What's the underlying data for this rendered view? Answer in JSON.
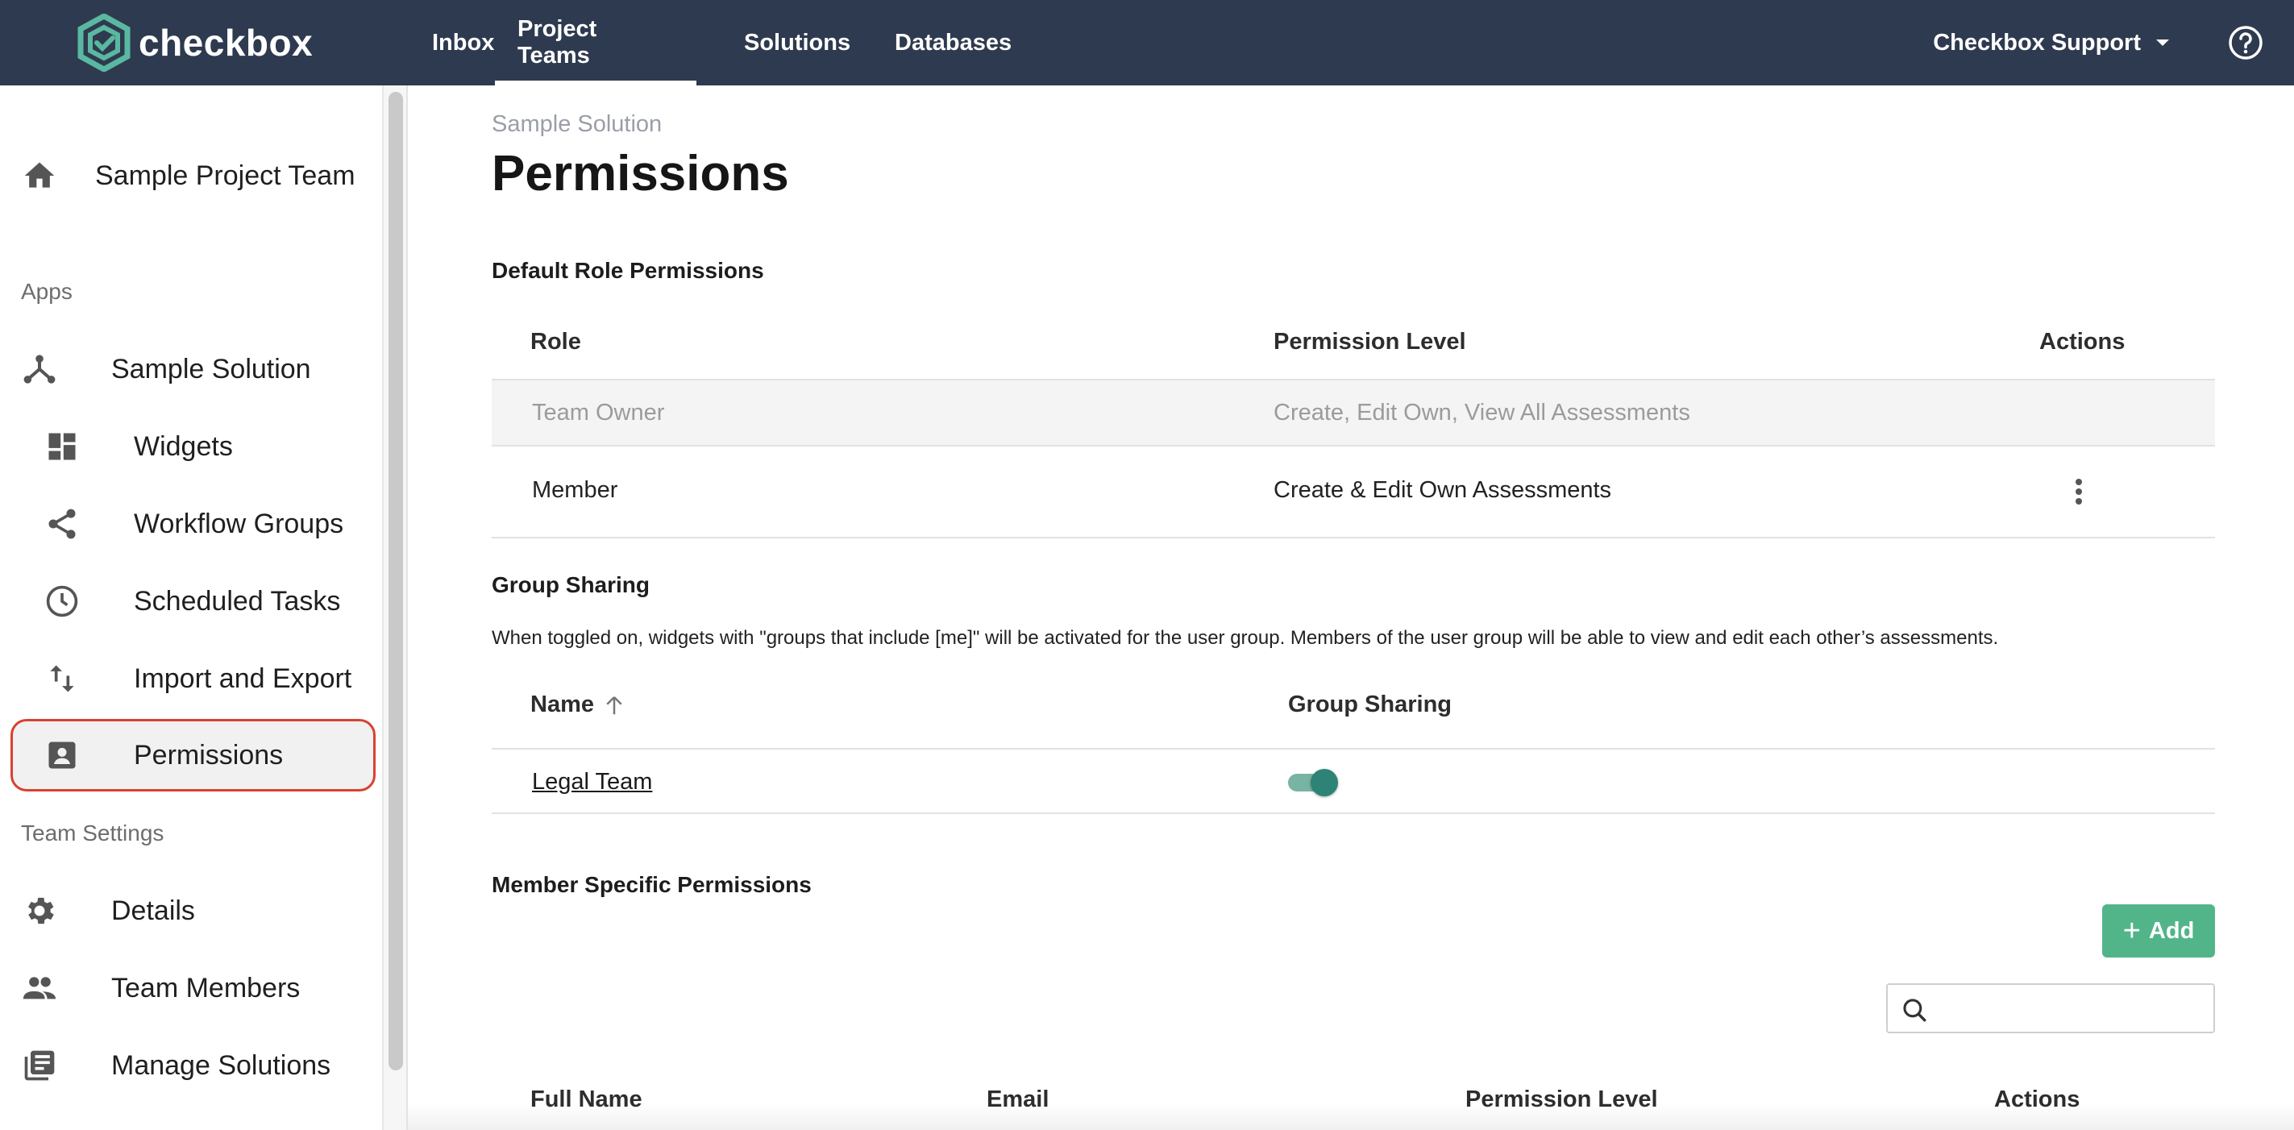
{
  "colors": {
    "topbar": "#2e3a4f",
    "accent_green": "#52b58a",
    "logo_green": "#5ab8a0",
    "selected_outline": "#d9412f",
    "toggle_on": "#2d8476"
  },
  "brand": {
    "name": "checkbox",
    "logo_icon": "checkbox-hexagon-logo"
  },
  "nav": {
    "items": [
      {
        "label": "Inbox"
      },
      {
        "label": "Project Teams",
        "active": true
      },
      {
        "label": "Solutions"
      },
      {
        "label": "Databases"
      }
    ],
    "user_menu_label": "Checkbox Support",
    "user_menu_icon": "caret-down-icon",
    "help_icon": "question-circle-icon"
  },
  "sidebar": {
    "team": {
      "label": "Sample Project Team",
      "icon": "home-icon"
    },
    "apps_heading": "Apps",
    "solution": {
      "label": "Sample Solution",
      "icon": "fork-icon"
    },
    "solution_items": [
      {
        "label": "Widgets",
        "icon": "dashboard-icon"
      },
      {
        "label": "Workflow Groups",
        "icon": "share-icon"
      },
      {
        "label": "Scheduled Tasks",
        "icon": "clock-icon"
      },
      {
        "label": "Import and Export",
        "icon": "import-export-icon"
      },
      {
        "label": "Permissions",
        "icon": "contact-card-icon",
        "selected": true
      }
    ],
    "team_settings_heading": "Team Settings",
    "settings_items": [
      {
        "label": "Details",
        "icon": "gear-icon"
      },
      {
        "label": "Team Members",
        "icon": "people-icon"
      },
      {
        "label": "Manage Solutions",
        "icon": "library-books-icon"
      }
    ]
  },
  "main": {
    "breadcrumb": "Sample Solution",
    "title": "Permissions",
    "default_roles": {
      "heading": "Default Role Permissions",
      "columns": {
        "role": "Role",
        "level": "Permission Level",
        "actions": "Actions"
      },
      "rows": [
        {
          "role": "Team Owner",
          "level": "Create, Edit Own, View All Assessments",
          "disabled": true
        },
        {
          "role": "Member",
          "level": "Create & Edit Own Assessments",
          "disabled": false
        }
      ],
      "row_action_icon": "more-vertical-icon"
    },
    "group_sharing": {
      "heading": "Group Sharing",
      "description": "When toggled on, widgets with \"groups that include [me]\" will be activated for the user group. Members of the user group will be able to view and edit each other’s assessments.",
      "columns": {
        "name": "Name",
        "sharing": "Group Sharing"
      },
      "sort_icon": "arrow-up-icon",
      "rows": [
        {
          "name": "Legal Team",
          "enabled": true
        }
      ]
    },
    "member_specific": {
      "heading": "Member Specific Permissions",
      "add_label": "Add",
      "search_placeholder": "",
      "search_icon": "search-icon",
      "columns": {
        "full_name": "Full Name",
        "email": "Email",
        "level": "Permission Level",
        "actions": "Actions"
      }
    }
  }
}
